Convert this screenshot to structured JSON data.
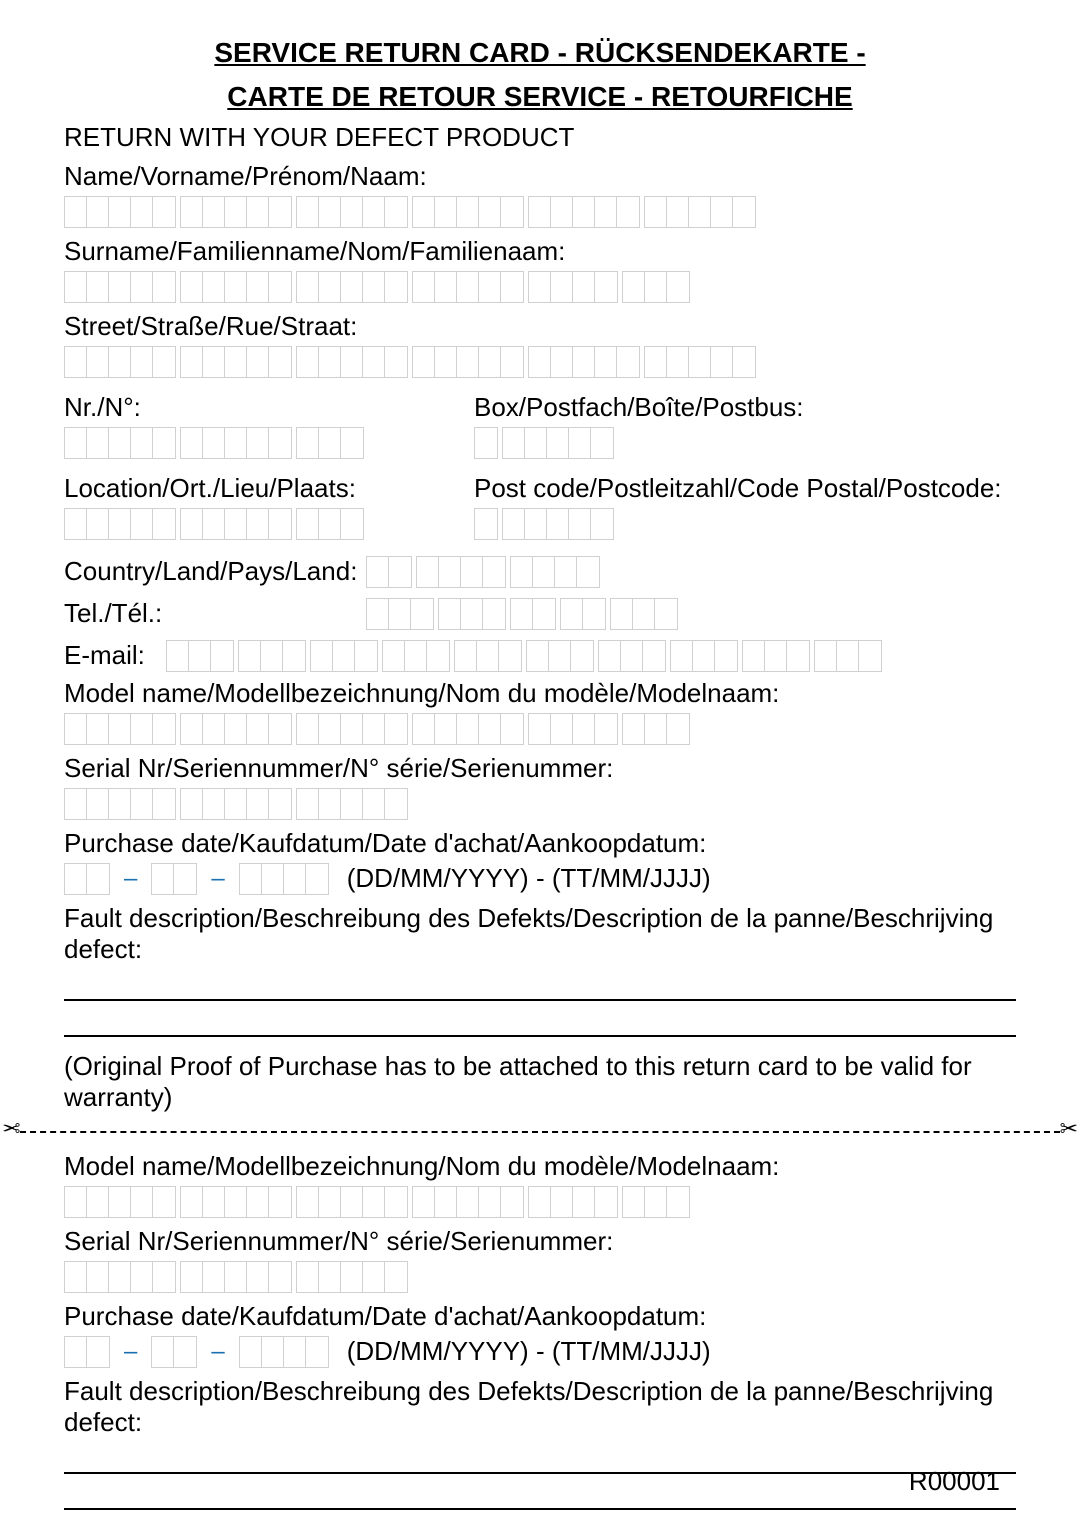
{
  "header": {
    "title_line1": "SERVICE RETURN CARD - RÜCKSENDEKARTE -",
    "title_line2": "CARTE DE RETOUR SERVICE - RETOURFICHE"
  },
  "instructions": "RETURN WITH YOUR DEFECT PRODUCT",
  "labels": {
    "name": "Name/Vorname/Prénom/Naam:",
    "surname": "Surname/Familienname/Nom/Familienaam:",
    "street": "Street/Straße/Rue/Straat:",
    "nr": "Nr./N°:",
    "box": "Box/Postfach/Boîte/Postbus:",
    "location": "Location/Ort./Lieu/Plaats:",
    "postcode": "Post code/Postleitzahl/Code Postal/Postcode:",
    "country": "Country/Land/Pays/Land:",
    "tel": "Tel./Tél.:",
    "email": "E-mail:",
    "model": "Model name/Modellbezeichnung/Nom du modèle/Modelnaam:",
    "serial": "Serial Nr/Seriennummer/N° série/Serienummer:",
    "purchase": "Purchase date/Kaufdatum/Date d'achat/Aankoopdatum:",
    "date_hint": "(DD/MM/YYYY) - (TT/MM/JJJJ)",
    "fault": "Fault description/Beschreibung des Defekts/Description de la panne/Beschrijving defect:"
  },
  "note": "(Original Proof of Purchase has to be attached to this return card to be valid for warranty)",
  "footer": "R00001",
  "box_groups": {
    "long30": [
      5,
      5,
      5,
      5,
      5,
      5
    ],
    "long27": [
      5,
      5,
      5,
      5,
      4,
      3
    ],
    "half13": [
      5,
      5,
      3
    ],
    "six": [
      1,
      5
    ],
    "tel": [
      3,
      3,
      2,
      2,
      3
    ],
    "country": [
      2,
      4,
      4
    ],
    "email": [
      3,
      3,
      3,
      3,
      3,
      3,
      3,
      3,
      3,
      3
    ],
    "serial": [
      5,
      5,
      5
    ],
    "dd": [
      2
    ],
    "mm": [
      2
    ],
    "yyyy": [
      4
    ]
  }
}
